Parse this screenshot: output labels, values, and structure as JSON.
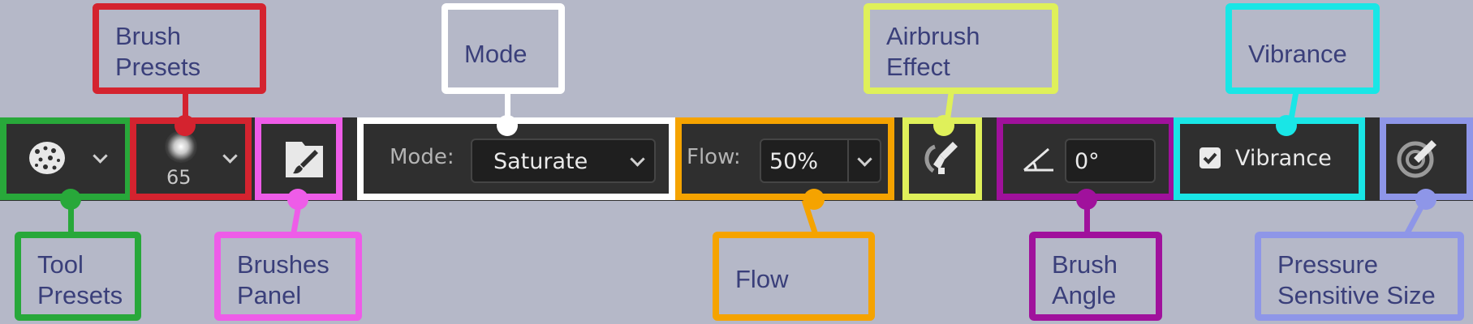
{
  "toolbar": {
    "brush_size": "65",
    "mode_label": "Mode:",
    "mode_value": "Saturate",
    "flow_label": "Flow:",
    "flow_value": "50%",
    "angle_value": "0°",
    "vibrance_label": "Vibrance",
    "vibrance_checked": true
  },
  "callouts": {
    "tool_presets": "Tool\nPresets",
    "brush_presets": "Brush\nPresets",
    "brushes_panel": "Brushes\nPanel",
    "mode": "Mode",
    "flow": "Flow",
    "airbrush": "Airbrush\nEffect",
    "brush_angle": "Brush\nAngle",
    "vibrance": "Vibrance",
    "pressure_size": "Pressure\nSensitive Size"
  },
  "colors": {
    "tool_presets": "#28a83a",
    "brush_presets": "#d4232f",
    "brushes_panel": "#ee5ce8",
    "mode": "#ffffff",
    "flow": "#f5a300",
    "airbrush": "#dff05a",
    "brush_angle": "#a0119c",
    "vibrance": "#19e6e6",
    "pressure_size": "#8e96e8"
  }
}
